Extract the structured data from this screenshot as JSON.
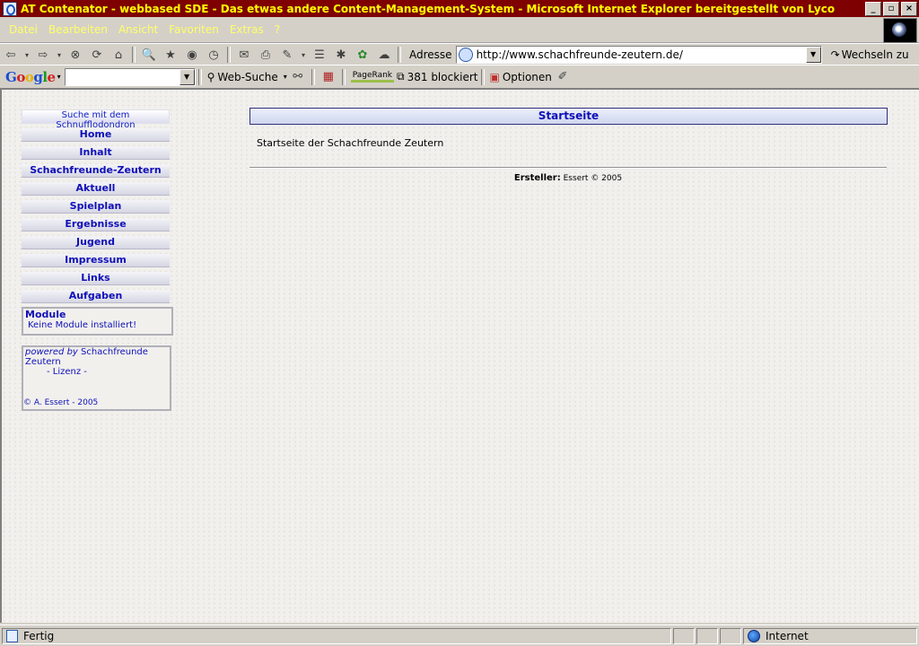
{
  "window": {
    "title": "AT Contenator - webbased SDE - Das etwas andere Content-Management-System - Microsoft Internet Explorer bereitgestellt von Lyco"
  },
  "menu": [
    "Datei",
    "Bearbeiten",
    "Ansicht",
    "Favoriten",
    "Extras",
    "?"
  ],
  "address": {
    "label": "Adresse",
    "url": "http://www.schachfreunde-zeutern.de/",
    "go_label": "Wechseln zu"
  },
  "google_toolbar": {
    "brand": "Google",
    "web_search": "Web-Suche",
    "pagerank": "PageRank",
    "blocked": "381 blockiert",
    "options": "Optionen"
  },
  "sidebar": {
    "search_link": "Suche mit dem Schnufflodondron",
    "nav": [
      "Home",
      "Inhalt",
      "Schachfreunde-Zeutern",
      "Aktuell",
      "Spielplan",
      "Ergebnisse",
      "Jugend",
      "Impressum",
      "Links",
      "Aufgaben"
    ],
    "modules": {
      "heading": "Module",
      "text": "Keine Module installiert!"
    },
    "powered": {
      "prefix": "powered by",
      "name": "Schachfreunde Zeutern",
      "license": "- Lizenz -",
      "copyright": "© A. Essert - 2005"
    }
  },
  "main": {
    "header": "Startseite",
    "text": "Startseite der Schachfreunde Zeutern",
    "footer_label": "Ersteller:",
    "footer_value": "Essert © 2005"
  },
  "status": {
    "text": "Fertig",
    "zone": "Internet"
  }
}
